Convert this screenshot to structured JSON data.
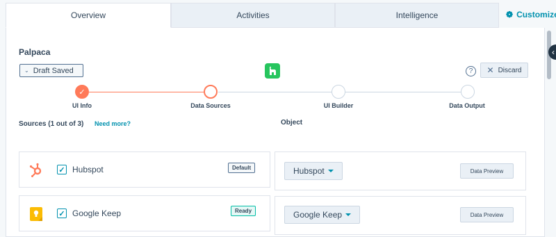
{
  "tabs": [
    {
      "label": "Overview",
      "active": true
    },
    {
      "label": "Activities",
      "active": false
    },
    {
      "label": "Intelligence",
      "active": false
    }
  ],
  "customize": {
    "label": "Customize",
    "icon": "gear-icon"
  },
  "title": "Palpaca",
  "draft_button": {
    "label": "Draft Saved",
    "icon": "chevron-down-icon"
  },
  "help_icon": "?",
  "discard_button": {
    "label": "Discard",
    "icon": "close-icon"
  },
  "steps": [
    {
      "label": "UI Info",
      "state": "done"
    },
    {
      "label": "Data Sources",
      "state": "current"
    },
    {
      "label": "UI Builder",
      "state": "pending"
    },
    {
      "label": "Data Output",
      "state": "pending"
    }
  ],
  "sources_heading": "Sources (1 out of 3)",
  "need_more_link": "Need more?",
  "object_heading": "Object",
  "sources": [
    {
      "name": "Hubspot",
      "checked": true,
      "tag": "Default",
      "tag_style": "default",
      "icon": "hubspot-icon",
      "object": "Hubspot",
      "preview": "Data Preview"
    },
    {
      "name": "Google Keep",
      "checked": true,
      "tag": "Ready",
      "tag_style": "ready",
      "icon": "google-keep-icon",
      "object": "Google Keep",
      "preview": "Data Preview"
    }
  ],
  "colors": {
    "accent": "#ff7a59",
    "link": "#0091ae",
    "success": "#00bda5",
    "text": "#33475b"
  }
}
